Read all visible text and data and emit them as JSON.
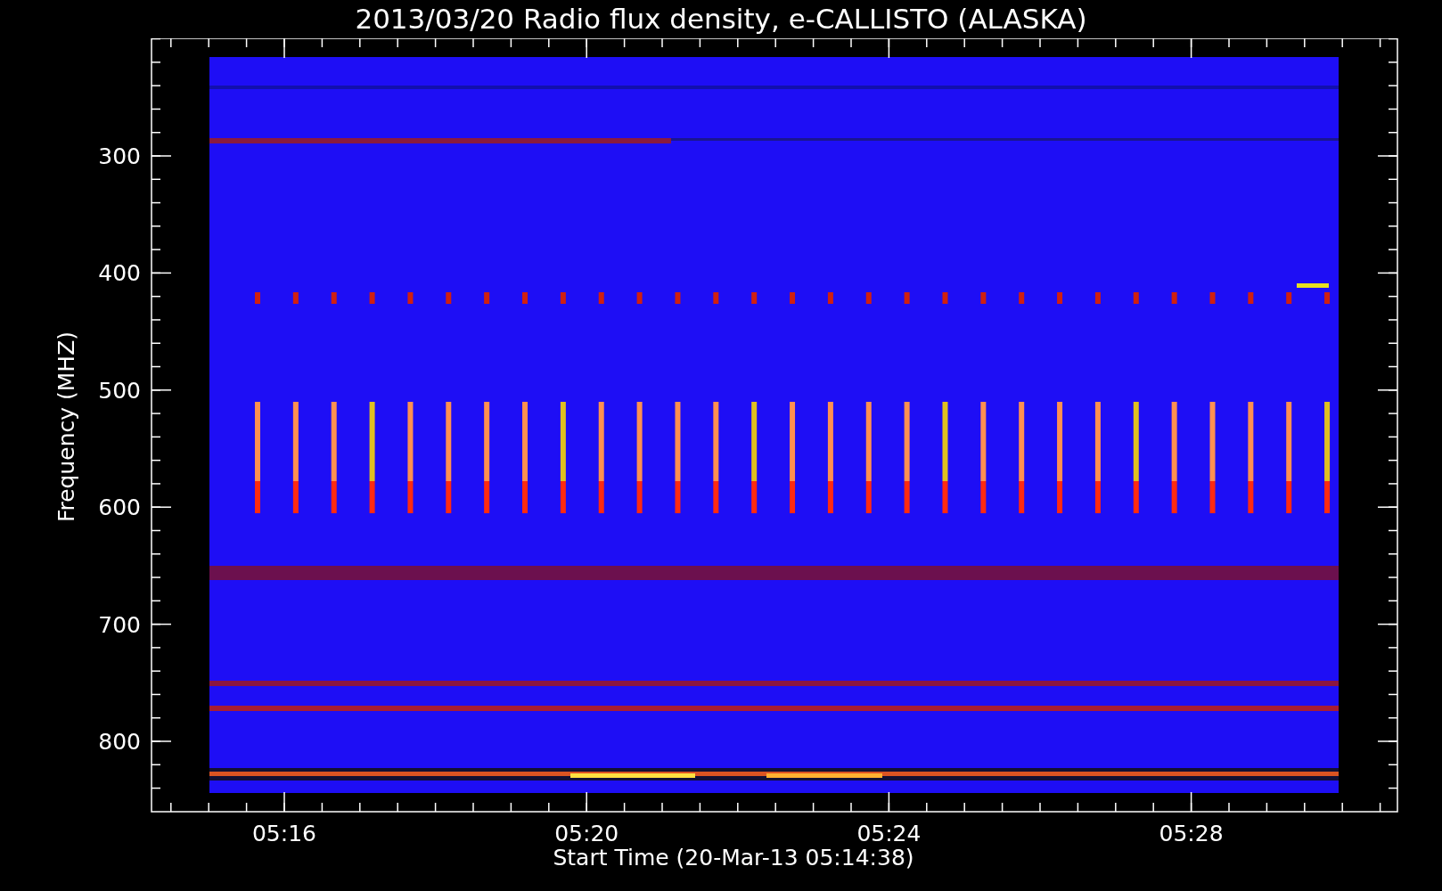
{
  "title": "2013/03/20  Radio flux density, e-CALLISTO (ALASKA)",
  "y_axis": {
    "label": "Frequency (MHZ)",
    "ticks": [
      "300",
      "400",
      "500",
      "600",
      "700",
      "800"
    ]
  },
  "x_axis": {
    "label": "Start Time (20-Mar-13 05:14:38)",
    "ticks": [
      "05:16",
      "05:20",
      "05:24",
      "05:28"
    ]
  }
}
